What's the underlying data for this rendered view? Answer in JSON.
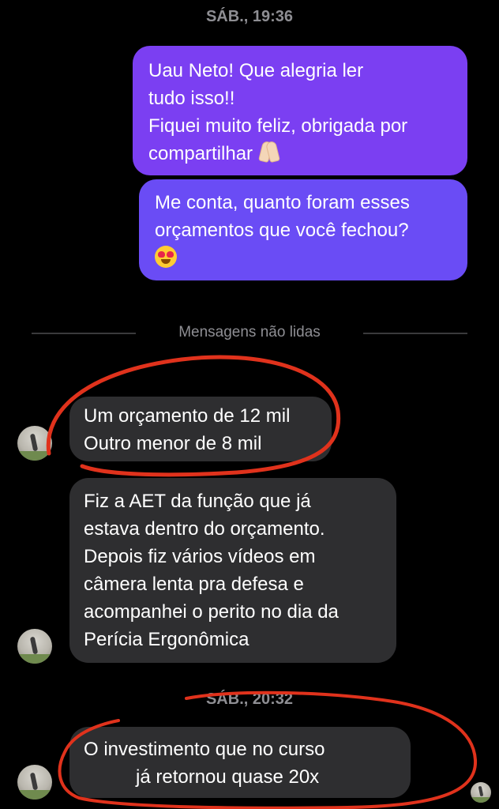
{
  "timestamps": {
    "first": "SÁB., 19:36",
    "second": "SÁB., 20:32"
  },
  "unread_divider": "Mensagens não lidas",
  "messages": {
    "out1": {
      "lines": [
        "Uau Neto! Que alegria ler",
        "tudo isso!!",
        "Fiquei muito feliz, obrigada por",
        "compartilhar"
      ],
      "emoji": "folded-hands-emoji"
    },
    "out2": {
      "lines": [
        "Me conta, quanto foram esses",
        "orçamentos que você fechou?"
      ],
      "emoji": "heart-eyes-emoji"
    },
    "in1": {
      "lines": [
        "Um orçamento de 12 mil",
        "Outro menor de 8 mil"
      ]
    },
    "in2": {
      "lines": [
        "Fiz a AET da função que já",
        "estava dentro do orçamento.",
        "Depois fiz vários vídeos em",
        "câmera lenta pra defesa e",
        "acompanhei o perito no dia da",
        "Perícia Ergonômica"
      ]
    },
    "in3": {
      "lines": [
        "O investimento que no curso",
        "já retornou quase 20x"
      ]
    }
  },
  "colors": {
    "outgoing_bubble": "#7b3ff2",
    "incoming_bubble": "#2e2e30",
    "annotation_red": "#e0321c"
  },
  "icons": {
    "avatar": "contact-avatar",
    "read_receipt": "read-receipt-avatar"
  }
}
